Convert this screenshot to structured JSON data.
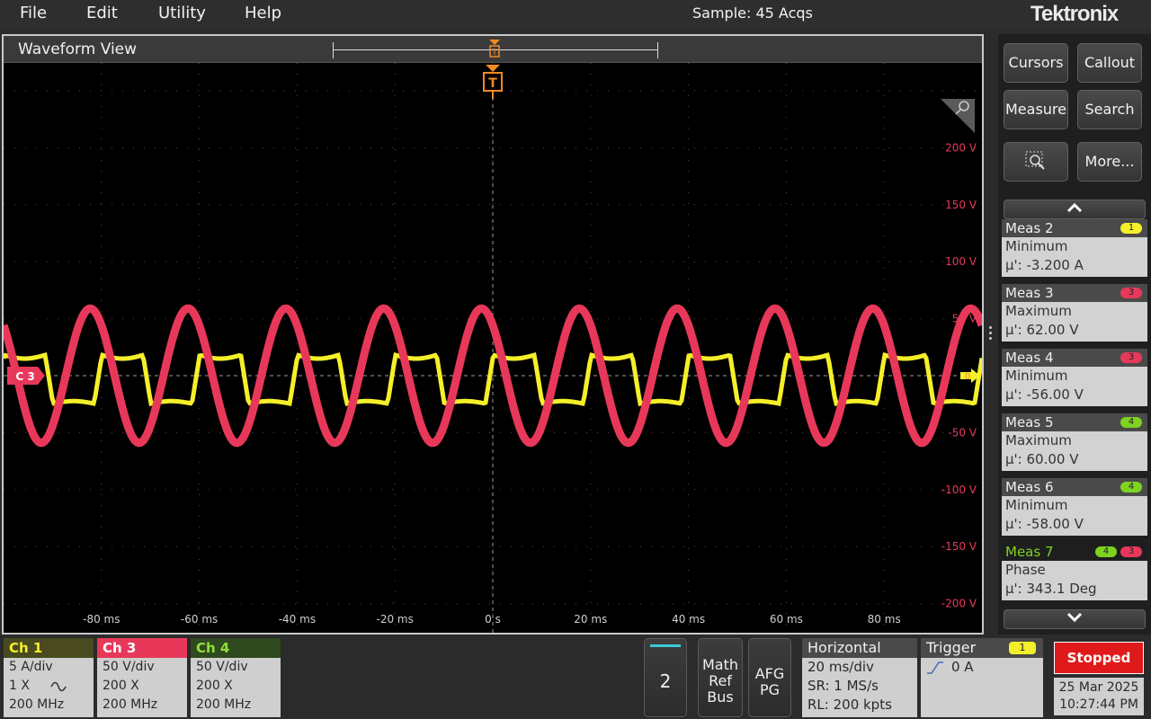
{
  "menu": {
    "file": "File",
    "edit": "Edit",
    "utility": "Utility",
    "help": "Help"
  },
  "status": "Sample: 45 Acqs",
  "brand": "Tektronix",
  "waveform_view": {
    "title": "Waveform View",
    "trigger_marker": "T",
    "channel_marker": "C 3",
    "ref_level_marker": "0",
    "y_labels": [
      "200 V",
      "150 V",
      "100 V",
      "50 V",
      "-50 V",
      "-100 V",
      "-150 V",
      "-200 V"
    ],
    "x_labels": [
      "-80 ms",
      "-60 ms",
      "-40 ms",
      "-20 ms",
      "0 s",
      "20 ms",
      "40 ms",
      "60 ms",
      "80 ms"
    ]
  },
  "side": {
    "cursors": "Cursors",
    "callout": "Callout",
    "measure": "Measure",
    "search": "Search",
    "more": "More...",
    "measurements": [
      {
        "title": "Meas 2",
        "type": "Minimum",
        "value": "μ': -3.200 A",
        "source": "1",
        "color": "#f5ef2a"
      },
      {
        "title": "Meas 3",
        "type": "Maximum",
        "value": "μ': 62.00 V",
        "source": "3",
        "color": "#e8385a"
      },
      {
        "title": "Meas 4",
        "type": "Minimum",
        "value": "μ': -56.00 V",
        "source": "3",
        "color": "#e8385a"
      },
      {
        "title": "Meas 5",
        "type": "Maximum",
        "value": "μ': 60.00 V",
        "source": "4",
        "color": "#7ed321"
      },
      {
        "title": "Meas 6",
        "type": "Minimum",
        "value": "μ': -58.00 V",
        "source": "4",
        "color": "#7ed321"
      },
      {
        "title": "Meas 7",
        "type": "Phase",
        "value": "μ': 343.1 Deg",
        "source": "4",
        "source2": "3",
        "color": "#7ed321"
      }
    ]
  },
  "channels": [
    {
      "label": "Ch 1",
      "scale": "5 A/div",
      "probe": "1 X",
      "bw": "200 MHz",
      "hdr_bg": "#4a4a20",
      "hdr_fg": "#f5ef2a"
    },
    {
      "label": "Ch 3",
      "scale": "50 V/div",
      "probe": "200 X",
      "bw": "200 MHz",
      "hdr_bg": "#e8385a",
      "hdr_fg": "#ffffff"
    },
    {
      "label": "Ch 4",
      "scale": "50 V/div",
      "probe": "200 X",
      "bw": "200 MHz",
      "hdr_bg": "#2f4a1e",
      "hdr_fg": "#8fe03a"
    }
  ],
  "bottom": {
    "add_channel": "2",
    "math_ref_bus": [
      "Math",
      "Ref",
      "Bus"
    ],
    "afg_pg": [
      "AFG",
      "PG"
    ],
    "horizontal": {
      "title": "Horizontal",
      "scale": "20 ms/div",
      "sr": "SR: 1 MS/s",
      "rl": "RL: 200 kpts"
    },
    "trigger": {
      "title": "Trigger",
      "source": "1",
      "level": "0 A"
    },
    "run_state": "Stopped",
    "date": "25 Mar 2025",
    "time": "10:27:44 PM"
  },
  "colors": {
    "ch1": "#f5ef2a",
    "ch3": "#e8385a",
    "ch4": "#7ed321",
    "trigger": "#f08a24",
    "axis_label": "#e8385a"
  }
}
